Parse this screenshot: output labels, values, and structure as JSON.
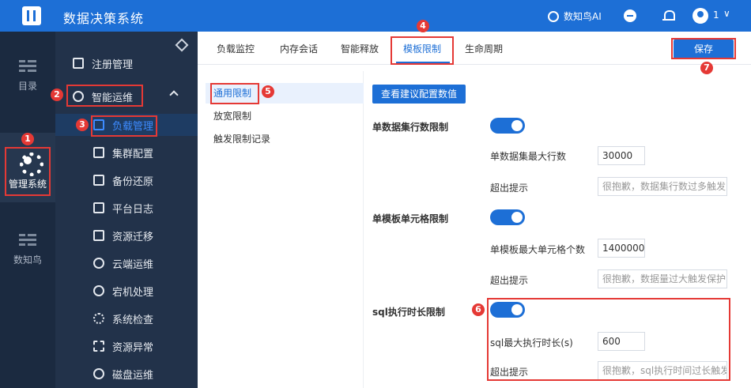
{
  "app": {
    "title": "数据决策系统",
    "ai_label": "数知鸟AI",
    "user_label": "1",
    "user_chevron": "∨"
  },
  "rail": {
    "items": [
      {
        "label": "目录",
        "icon": "list-icon"
      },
      {
        "label": "管理系统",
        "icon": "gear-icon"
      },
      {
        "label": "数知鸟",
        "icon": "list-icon"
      }
    ]
  },
  "sidebar": {
    "items": [
      {
        "label": "注册管理",
        "icon": "register-icon"
      },
      {
        "label": "智能运维",
        "icon": "smart-ops-icon"
      },
      {
        "label": "负载管理",
        "icon": "load-icon"
      },
      {
        "label": "集群配置",
        "icon": "cluster-icon"
      },
      {
        "label": "备份还原",
        "icon": "backup-icon"
      },
      {
        "label": "平台日志",
        "icon": "log-icon"
      },
      {
        "label": "资源迁移",
        "icon": "migrate-icon"
      },
      {
        "label": "云端运维",
        "icon": "cloud-icon"
      },
      {
        "label": "宕机处理",
        "icon": "crash-icon"
      },
      {
        "label": "系统检查",
        "icon": "check-icon"
      },
      {
        "label": "资源异常",
        "icon": "anomaly-icon"
      },
      {
        "label": "磁盘运维",
        "icon": "disk-icon"
      }
    ]
  },
  "tabs": [
    {
      "label": "负载监控"
    },
    {
      "label": "内存会话"
    },
    {
      "label": "智能释放"
    },
    {
      "label": "模板限制"
    },
    {
      "label": "生命周期"
    }
  ],
  "save_label": "保存",
  "submenu": [
    {
      "label": "通用限制"
    },
    {
      "label": "放宽限制"
    },
    {
      "label": "触发限制记录"
    }
  ],
  "config": {
    "suggest_label": "查看建议配置数值",
    "groups": [
      {
        "title": "单数据集行数限制",
        "enabled": true,
        "limit_label": "单数据集最大行数",
        "limit_value": "30000",
        "hint_label": "超出提示",
        "hint_value": "很抱歉，数据集行数过多触发"
      },
      {
        "title": "单模板单元格限制",
        "enabled": true,
        "limit_label": "单模板最大单元格个数",
        "limit_value": "1400000",
        "hint_label": "超出提示",
        "hint_value": "很抱歉，数据量过大触发保护"
      },
      {
        "title": "sql执行时长限制",
        "enabled": true,
        "limit_label": "sql最大执行时长(s)",
        "limit_value": "600",
        "hint_label": "超出提示",
        "hint_value": "很抱歉，sql执行时间过长触发"
      }
    ]
  },
  "annotations": [
    "1",
    "2",
    "3",
    "4",
    "5",
    "6",
    "7"
  ],
  "colors": {
    "topbar": "#1d6fd6",
    "rail": "#1b2a40",
    "sidebar": "#22324a",
    "annotation": "#e53935"
  }
}
